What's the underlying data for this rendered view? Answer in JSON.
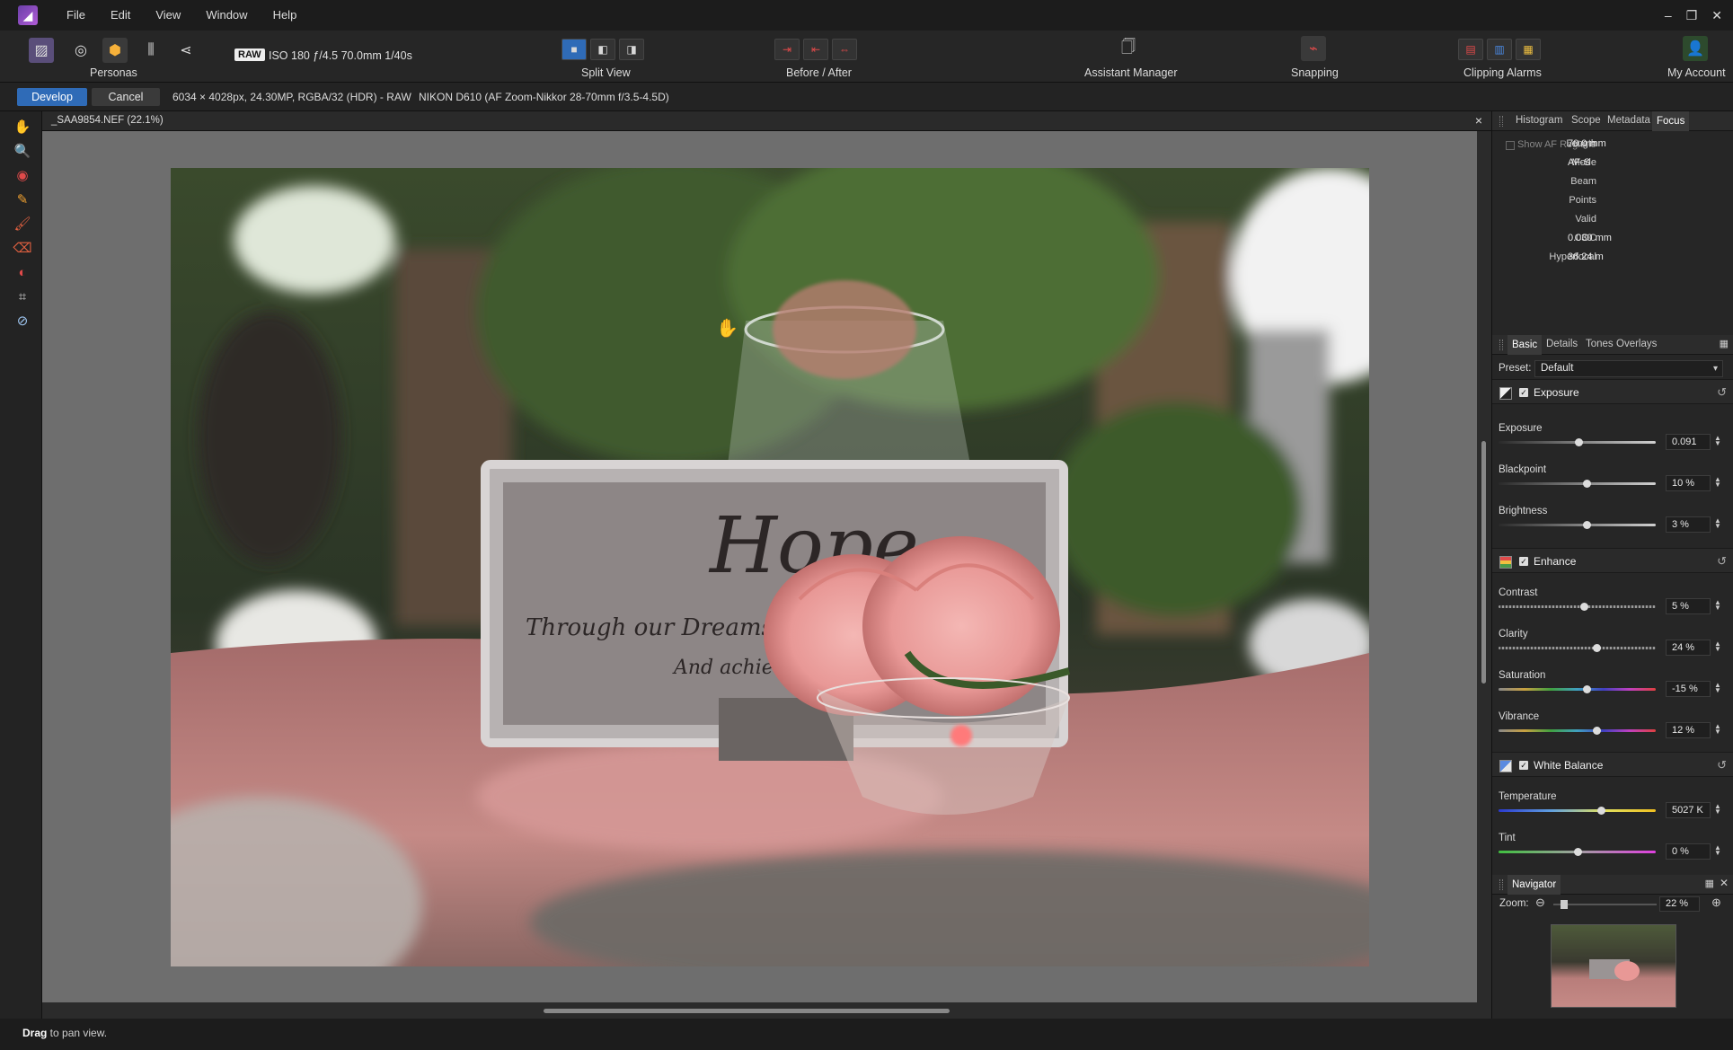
{
  "menu": {
    "items": [
      "File",
      "Edit",
      "View",
      "Window",
      "Help"
    ]
  },
  "toolbar": {
    "personas_label": "Personas",
    "raw_badge": "RAW",
    "exif": "ISO 180 ƒ/4.5 70.0mm 1/40s",
    "split_view_label": "Split View",
    "before_after_label": "Before / After",
    "assistant_manager_label": "Assistant Manager",
    "snapping_label": "Snapping",
    "clipping_alarms_label": "Clipping Alarms",
    "my_account_label": "My Account"
  },
  "context": {
    "develop_label": "Develop",
    "cancel_label": "Cancel",
    "image_info": "6034 × 4028px, 24.30MP, RGBA/32 (HDR) - RAW",
    "camera_info": "NIKON D610 (AF Zoom-Nikkor 28-70mm f/3.5-4.5D)"
  },
  "document": {
    "tab_title": "_SAA9854.NEF (22.1%)"
  },
  "photo": {
    "card_title": "Hope",
    "card_line1": "Through our Dreams, Hope s",
    "card_line2": "And achiever the"
  },
  "status": {
    "bold": "Drag",
    "rest": " to pan view."
  },
  "info_panel": {
    "tabs": [
      "Histogram",
      "Scope",
      "Metadata",
      "Focus"
    ],
    "active_tab": "Focus",
    "show_af_regions": "Show AF Regions",
    "rows": [
      {
        "key": "Length",
        "value": "70.0 mm"
      },
      {
        "key": "Mode",
        "value": "AF-S"
      },
      {
        "key": "Beam",
        "value": ""
      },
      {
        "key": "Points",
        "value": ""
      },
      {
        "key": "Valid",
        "value": ""
      },
      {
        "key": "COC",
        "value": "0.030 mm"
      },
      {
        "key": "Hyperfocal",
        "value": "36.24 m"
      }
    ]
  },
  "develop_panel": {
    "tabs": [
      "Basic",
      "Details",
      "Tones",
      "Overlays"
    ],
    "active_tab": "Basic",
    "preset_label": "Preset:",
    "preset_value": "Default",
    "sections": {
      "exposure": "Exposure",
      "enhance": "Enhance",
      "white_balance": "White Balance"
    },
    "sliders": {
      "exposure": {
        "label": "Exposure",
        "value": "0.091",
        "level": 0.51
      },
      "blackpoint": {
        "label": "Blackpoint",
        "value": "10 %",
        "level": 0.56
      },
      "brightness": {
        "label": "Brightness",
        "value": "3 %",
        "level": 0.56
      },
      "contrast": {
        "label": "Contrast",
        "value": "5 %",
        "level": 0.54
      },
      "clarity": {
        "label": "Clarity",
        "value": "24 %",
        "level": 0.62
      },
      "saturation": {
        "label": "Saturation",
        "value": "-15 %",
        "level": 0.56
      },
      "vibrance": {
        "label": "Vibrance",
        "value": "12 %",
        "level": 0.62
      },
      "temperature": {
        "label": "Temperature",
        "value": "5027 K",
        "level": 0.65
      },
      "tint": {
        "label": "Tint",
        "value": "0 %",
        "level": 0.5
      }
    }
  },
  "navigator": {
    "title": "Navigator",
    "zoom_label": "Zoom:",
    "zoom_value": "22 %"
  },
  "colors": {
    "accent": "#2f6bb7",
    "panel_bg": "#262626",
    "canvas_bg": "#6e6e6e"
  }
}
